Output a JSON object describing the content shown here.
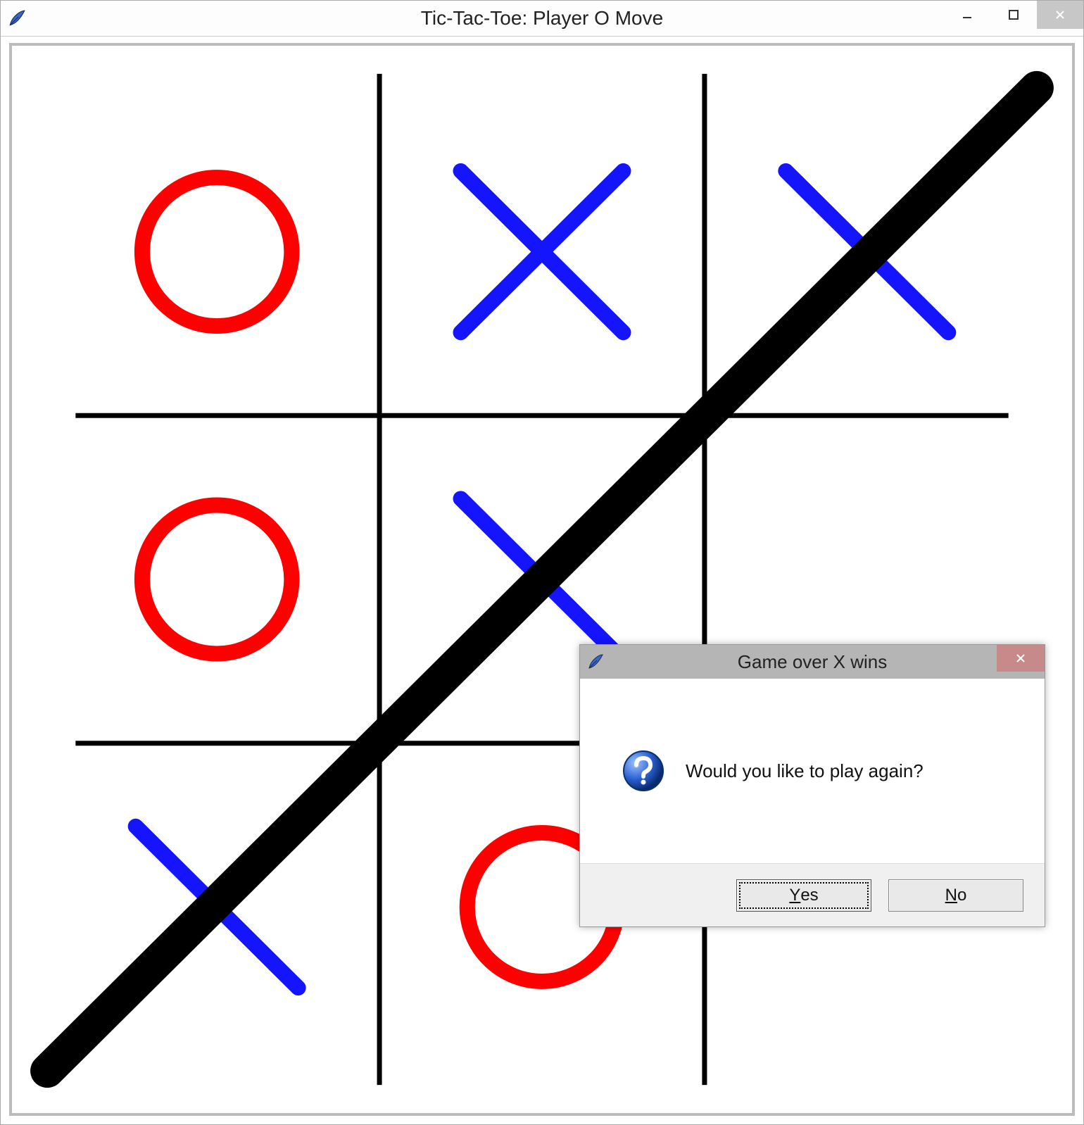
{
  "window": {
    "title": "Tic-Tac-Toe: Player O Move"
  },
  "board": {
    "cells": [
      [
        "O",
        "X",
        "X"
      ],
      [
        "O",
        "X",
        ""
      ],
      [
        "X",
        "O",
        ""
      ]
    ],
    "winning_line": "anti-diagonal"
  },
  "dialog": {
    "title": "Game over  X wins",
    "message": "Would you like to play again?",
    "yes_label": "Yes",
    "no_label": "No",
    "yes_mnemonic": "Y",
    "no_mnemonic": "N"
  },
  "colors": {
    "x": "#1414ff",
    "o": "#ff0000",
    "grid": "#000000",
    "win_line": "#000000"
  }
}
